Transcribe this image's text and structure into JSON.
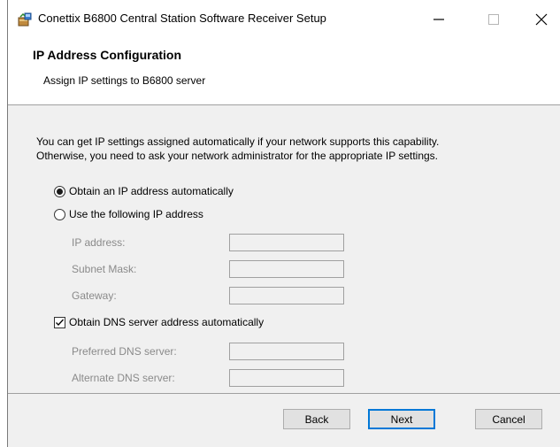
{
  "window": {
    "title": "Conettix B6800 Central Station Software Receiver Setup",
    "minimize_label": "—",
    "maximize_icon": "maximize-icon",
    "close_label": "✕"
  },
  "header": {
    "title": "IP Address Configuration",
    "subtitle": "Assign IP settings to B6800 server"
  },
  "description": {
    "line1": "You can get IP settings assigned automatically if your network supports this capability.",
    "line2": "Otherwise, you need to ask your network administrator for the appropriate IP settings."
  },
  "ip_options": {
    "auto_label": "Obtain an IP address automatically",
    "auto_selected": true,
    "manual_label": "Use the following IP address",
    "manual_selected": false
  },
  "ip_fields": {
    "ip_label": "IP address:",
    "ip_value": "",
    "subnet_label": "Subnet Mask:",
    "subnet_value": "",
    "gateway_label": "Gateway:",
    "gateway_value": ""
  },
  "dns": {
    "auto_label": "Obtain DNS server address automatically",
    "auto_checked": true,
    "preferred_label": "Preferred DNS server:",
    "preferred_value": "",
    "alternate_label": "Alternate DNS server:",
    "alternate_value": ""
  },
  "buttons": {
    "back": "Back",
    "next": "Next",
    "cancel": "Cancel"
  },
  "colors": {
    "default_button_border": "#0078d7",
    "window_bg": "#f0f0f0",
    "disabled_text": "#8a8a8a"
  }
}
